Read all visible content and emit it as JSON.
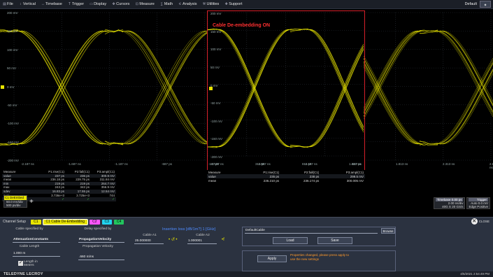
{
  "menu": [
    {
      "icon": "file-icon",
      "label": "File"
    },
    {
      "icon": "vertical-icon",
      "label": "Vertical"
    },
    {
      "icon": "timebase-icon",
      "label": "Timebase"
    },
    {
      "icon": "trigger-icon",
      "label": "Trigger"
    },
    {
      "icon": "display-icon",
      "label": "Display"
    },
    {
      "icon": "cursors-icon",
      "label": "Cursors"
    },
    {
      "icon": "measure-icon",
      "label": "Measure"
    },
    {
      "icon": "math-icon",
      "label": "Math"
    },
    {
      "icon": "analysis-icon",
      "label": "Analysis"
    },
    {
      "icon": "utilities-icon",
      "label": "Utilities"
    },
    {
      "icon": "support-icon",
      "label": "Support"
    }
  ],
  "menu_right": {
    "default_label": "Default"
  },
  "grid": {
    "y_labels": [
      "200 mV",
      "150 mV",
      "100 mV",
      "50 mV",
      "0 mV",
      "-50 mV",
      "-100 mV",
      "-150 mV",
      "-200 mV"
    ],
    "x_labels": [
      "-2.187 ns",
      "-1.687 ns",
      "-1.187 ns",
      "-687 ps",
      "-187 ps",
      "313 ps",
      "813 ps",
      "1.313 ns",
      "1.813 ns",
      "2.313 ns",
      "2.813 ns"
    ],
    "trace_color": "#e8e400"
  },
  "overlay": {
    "title": "Cable De-embedding ON",
    "y_labels": [
      "200 mV",
      "150 mV",
      "100 mV",
      "50 mV",
      "0 mV",
      "-50 mV",
      "-100 mV",
      "-150 mV",
      "-200 mV"
    ],
    "x_labels": [
      "-2.187 ns",
      "-1.687 ns",
      "-1.187 ns",
      "-687 ps"
    ],
    "table": {
      "headers": [
        "Measure",
        "P1:rise(C1)",
        "P2:fall(C1)",
        "P3:ampl(C1)"
      ],
      "rows": [
        [
          "value",
          "235 ps",
          "238 ps",
          "299.5 mV"
        ],
        [
          "mean",
          "236.210 ps",
          "236.174 ps",
          "300.005 mV"
        ]
      ]
    },
    "border_color": "#d8202a"
  },
  "measure": {
    "headers": [
      "Measure",
      "P1:rise(C1)",
      "P2:fall(C1)",
      "P3:ampl(C1)"
    ],
    "rows": [
      [
        "value",
        "237 ps",
        "236 ps",
        "300.9 mV"
      ],
      [
        "mean",
        "236.18 ps",
        "229.75 ps",
        "311.84 mV"
      ],
      [
        "min",
        "219 ps",
        "219 ps",
        "264.7 mV"
      ],
      [
        "max",
        "243 ps",
        "342 ps",
        "356.9 mV"
      ],
      [
        "sdev",
        "16.83 ps",
        "17.55 ps",
        "12.54 mV"
      ],
      [
        "num",
        "3.736e+3",
        "3.725e+3",
        "744"
      ],
      [
        "status",
        "✓",
        "✓",
        "✓"
      ]
    ]
  },
  "channel": {
    "name": "C1",
    "mode": "DeEmbed",
    "scale": "50.0 mV/div",
    "offset": "500 ps/div"
  },
  "plus_label": "+",
  "timebase": {
    "head1": "Timebase",
    "head1_val": "0.00 ps",
    "head2": "Trigger",
    "l1a": "2.00 ns/div",
    "l1b": "Auto",
    "l1c": "0.0 mV",
    "l2a": "40G S",
    "l2b": "20 GS/s",
    "l2c": "Edge",
    "l2d": "Positive"
  },
  "dialog": {
    "tab_label": "Channel Setup",
    "tabs": [
      {
        "label": "C1",
        "bg": "#e8e400"
      },
      {
        "label": "C1 Cable De-Embedding",
        "bg": "#e8e400"
      },
      {
        "label": "C2",
        "bg": "#ff55ff"
      },
      {
        "label": "C3",
        "bg": "#22d3ee"
      },
      {
        "label": "C4",
        "bg": "#22c55e"
      }
    ],
    "close_label": "CLOSE",
    "cable_spec_label": "Cable specified by",
    "cable_spec_value": "AttenuationConstants",
    "cable_length_label": "Cable Length",
    "cable_length_value": "1.000 m",
    "length_in_meters_label": "Length in Meters",
    "delay_spec_label": "Delay specified by",
    "delay_spec_value": "PropagationVelocity",
    "prop_velocity_label": "Propagation Velocity",
    "prop_velocity_value": ".660 m/ns",
    "insertion_title": "Insertion loss [dB/1m?] 1 [GHz]",
    "cable_a1_label": "Cable A1",
    "cable_a1_value": "25.000000",
    "cable_a2_label": "Cable A2",
    "cable_a2_value": "1.000001",
    "file_value": "DefaultCable",
    "browse_label": "Browse",
    "load_label": "Load",
    "save_label": "Save",
    "apply_label": "Apply",
    "notice": "Properties changed, please press apply to use the new settings"
  },
  "status": {
    "brand": "TELEDYNE LECROY",
    "datetime": "4/5/2021 2:54:49 PM"
  }
}
